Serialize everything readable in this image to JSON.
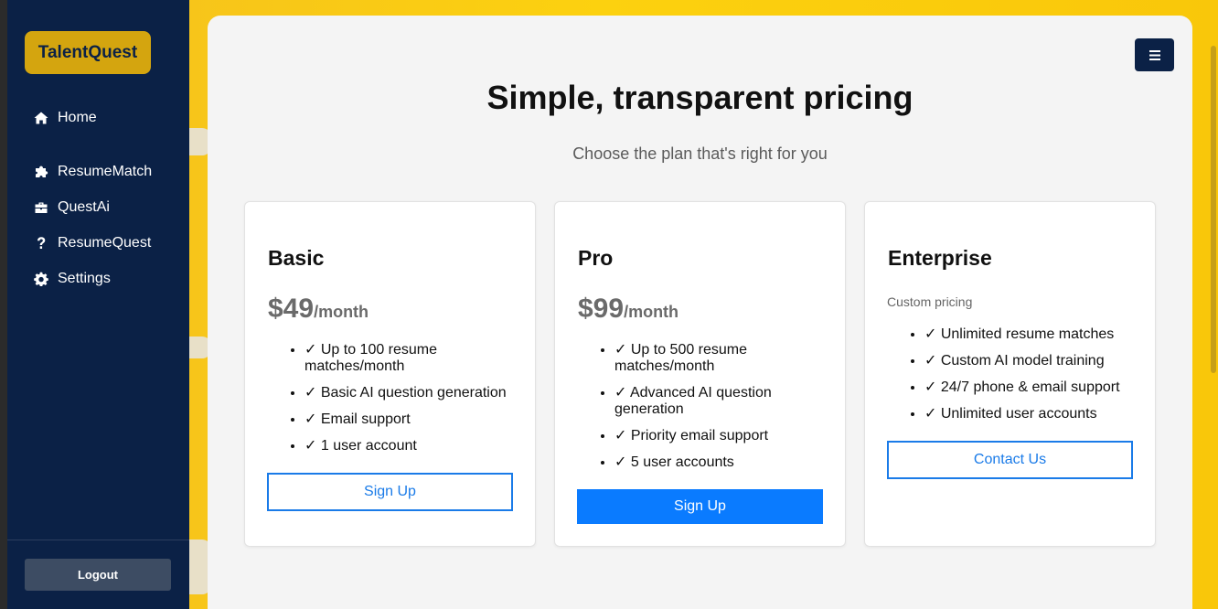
{
  "brand": {
    "name": "TalentQuest",
    "color": "#d4a50f"
  },
  "sidebar": {
    "items": [
      {
        "label": "Home",
        "icon": "home-icon"
      },
      {
        "label": "ResumeMatch",
        "icon": "puzzle-icon"
      },
      {
        "label": "QuestAi",
        "icon": "briefcase-icon"
      },
      {
        "label": "ResumeQuest",
        "icon": "question-icon"
      },
      {
        "label": "Settings",
        "icon": "gear-icon"
      }
    ],
    "logout_label": "Logout"
  },
  "header": {
    "menu_icon": "hamburger-menu-icon"
  },
  "pricing": {
    "title": "Simple, transparent pricing",
    "subtitle": "Choose the plan that's right for you",
    "plans": [
      {
        "name": "Basic",
        "price": "$49",
        "period": "/month",
        "features": [
          "✓ Up to 100 resume matches/month",
          "✓ Basic AI question generation",
          "✓ Email support",
          "✓ 1 user account"
        ],
        "button": "Sign Up"
      },
      {
        "name": "Pro",
        "price": "$99",
        "period": "/month",
        "features": [
          "✓ Up to 500 resume matches/month",
          "✓ Advanced AI question generation",
          "✓ Priority email support",
          "✓ 5 user accounts"
        ],
        "button": "Sign Up"
      },
      {
        "name": "Enterprise",
        "price_note": "Custom pricing",
        "features": [
          "✓ Unlimited resume matches",
          "✓ Custom AI model training",
          "✓ 24/7 phone & email support",
          "✓ Unlimited user accounts"
        ],
        "button": "Contact Us"
      }
    ]
  },
  "colors": {
    "sidebar_bg": "#0b2146",
    "accent_blue": "#0a7bff",
    "background_yellow": "#fcd10f"
  }
}
